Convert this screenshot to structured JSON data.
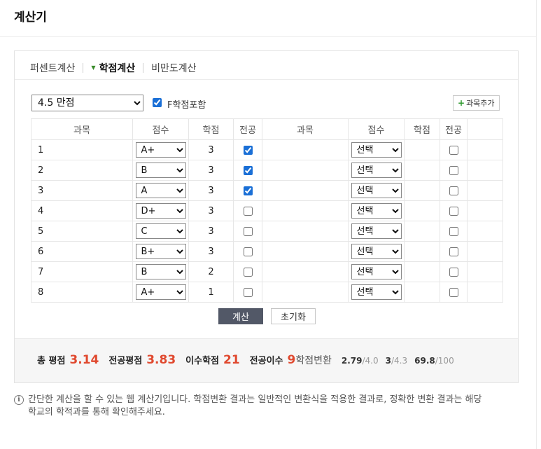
{
  "page": {
    "title": "계산기"
  },
  "tabs": [
    {
      "label": "퍼센트계산",
      "active": false
    },
    {
      "label": "학점계산",
      "active": true
    },
    {
      "label": "비만도계산",
      "active": false
    }
  ],
  "controls": {
    "scale_selected": "4.5 만점",
    "f_grade_label": "F학점포함",
    "f_grade_checked": true,
    "add_course_label": "과목추가"
  },
  "table": {
    "headers": [
      "과목",
      "점수",
      "학점",
      "전공",
      "과목",
      "점수",
      "학점",
      "전공"
    ],
    "left_rows": [
      {
        "subject": "1",
        "grade": "A+",
        "credit": "3",
        "major": true
      },
      {
        "subject": "2",
        "grade": "B",
        "credit": "3",
        "major": true
      },
      {
        "subject": "3",
        "grade": "A",
        "credit": "3",
        "major": true
      },
      {
        "subject": "4",
        "grade": "D+",
        "credit": "3",
        "major": false
      },
      {
        "subject": "5",
        "grade": "C",
        "credit": "3",
        "major": false
      },
      {
        "subject": "6",
        "grade": "B+",
        "credit": "3",
        "major": false
      },
      {
        "subject": "7",
        "grade": "B",
        "credit": "2",
        "major": false
      },
      {
        "subject": "8",
        "grade": "A+",
        "credit": "1",
        "major": false
      }
    ],
    "right_rows": [
      {
        "subject": "",
        "grade": "선택",
        "credit": "",
        "major": false
      },
      {
        "subject": "",
        "grade": "선택",
        "credit": "",
        "major": false
      },
      {
        "subject": "",
        "grade": "선택",
        "credit": "",
        "major": false
      },
      {
        "subject": "",
        "grade": "선택",
        "credit": "",
        "major": false
      },
      {
        "subject": "",
        "grade": "선택",
        "credit": "",
        "major": false
      },
      {
        "subject": "",
        "grade": "선택",
        "credit": "",
        "major": false
      },
      {
        "subject": "",
        "grade": "선택",
        "credit": "",
        "major": false
      },
      {
        "subject": "",
        "grade": "선택",
        "credit": "",
        "major": false
      }
    ]
  },
  "buttons": {
    "calculate": "계산",
    "reset": "초기화"
  },
  "summary": {
    "gpa_label": "총 평점",
    "gpa_value": "3.14",
    "major_gpa_label": "전공평점",
    "major_gpa_value": "3.83",
    "credits_label": "이수학점",
    "credits_value": "21",
    "major_credits_label": "전공이수",
    "major_credits_value": "9",
    "conversion_label": "학점변환",
    "conversions": [
      {
        "value": "2.79",
        "max": "/4.0"
      },
      {
        "value": "3",
        "max": "/4.3"
      },
      {
        "value": "69.8",
        "max": "/100"
      }
    ]
  },
  "note": {
    "line1": "간단한 계산을 할 수 있는 웹 계산기입니다. 학점변환 결과는 일반적인 변환식을 적용한 결과로, 정확한 변환 결과는 해당",
    "line2": "학교의 학적과를 통해 확인해주세요."
  },
  "colors": {
    "accent_red": "#e0492f",
    "calc_button": "#525867",
    "active_tab_marker": "#3a8b2a"
  }
}
